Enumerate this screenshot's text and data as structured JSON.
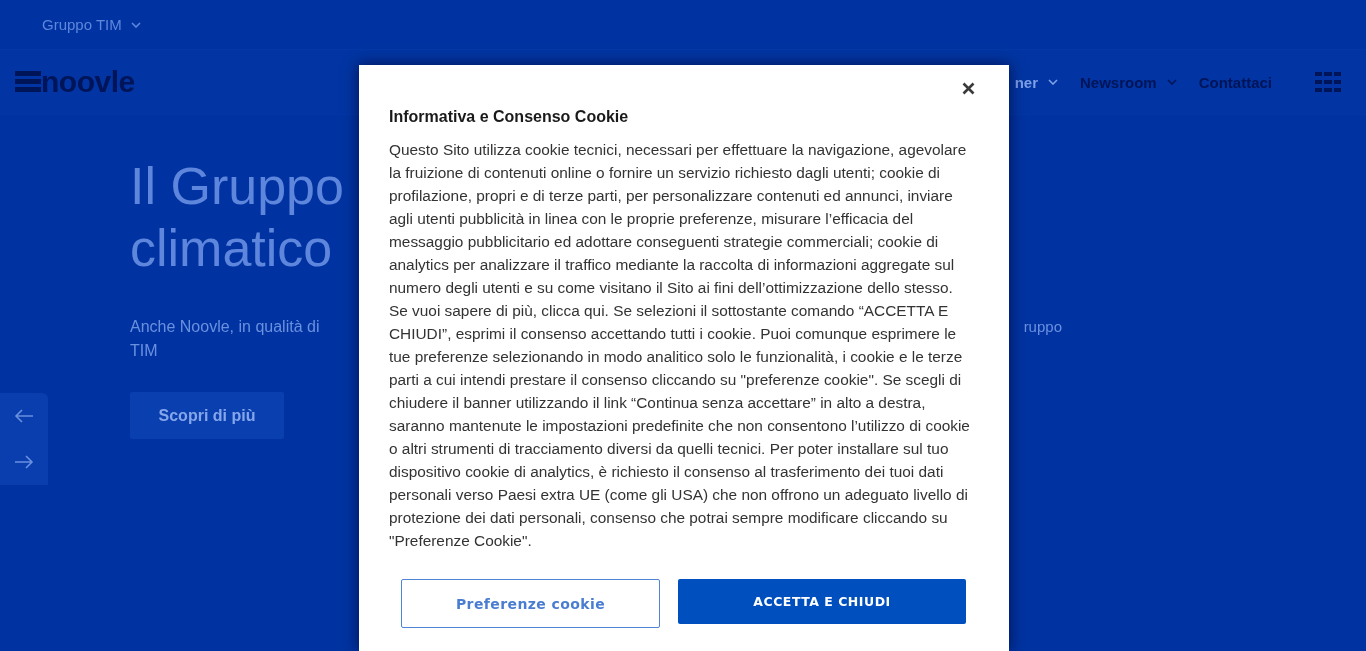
{
  "top_bar": {
    "group_menu": {
      "label": "Gruppo TIM",
      "has_dropdown": true
    }
  },
  "header": {
    "logo": {
      "wordmark": "noovle"
    },
    "nav": [
      {
        "label": "ner",
        "has_dropdown": true
      },
      {
        "label": "Newsroom",
        "has_dropdown": true
      },
      {
        "label": "Contattaci",
        "has_dropdown": false
      }
    ]
  },
  "hero": {
    "title_lines": [
      "Il Gruppo",
      "climatico"
    ],
    "subtitle_lines": [
      {
        "left": "Anche Noovle, in qualità di",
        "right": "ruppo"
      },
      {
        "left": "TIM"
      }
    ],
    "button": "Scopri di più"
  },
  "cookie_dialog": {
    "title": "Informativa e Consenso Cookie",
    "text": "Questo Sito utilizza cookie tecnici, necessari per effettuare la navigazione, agevolare la fruizione di contenuti online o fornire un servizio richiesto dagli utenti; cookie di profilazione, propri e di terze parti, per personalizzare contenuti ed annunci, inviare agli utenti pubblicità in linea con le proprie preferenze, misurare l’efficacia del messaggio pubblicitario ed adottare conseguenti strategie commerciali; cookie di analytics per analizzare il traffico mediante la raccolta di informazioni aggregate sul numero degli utenti e su come visitano il Sito ai fini dell’ottimizzazione dello stesso. Se vuoi sapere di più, clicca qui. Se selezioni il sottostante comando “ACCETTA E CHIUDI”, esprimi il consenso accettando tutti i cookie. Puoi comunque esprimere le tue preferenze selezionando in modo analitico solo le funzionalità, i cookie e le terze parti a cui intendi prestare il consenso cliccando su \"preferenze cookie\". Se scegli di chiudere il banner utilizzando il link “Continua senza accettare” in alto a destra, saranno mantenute le impostazioni predefinite che non consentono l’utilizzo di cookie o altri strumenti di tracciamento diversi da quelli tecnici. Per poter installare sul tuo dispositivo cookie di analytics, è richiesto il consenso al trasferimento dei tuoi dati personali verso Paesi extra UE (come gli USA) che non offrono un adeguato livello di protezione dei dati personali, consenso che potrai sempre modificare cliccando su \"Preferenze Cookie\".",
    "buttons": [
      {
        "label": "Preferenze cookie",
        "kind": "secondary"
      },
      {
        "label": "ACCETTA E CHIUDI",
        "kind": "primary"
      }
    ]
  }
}
